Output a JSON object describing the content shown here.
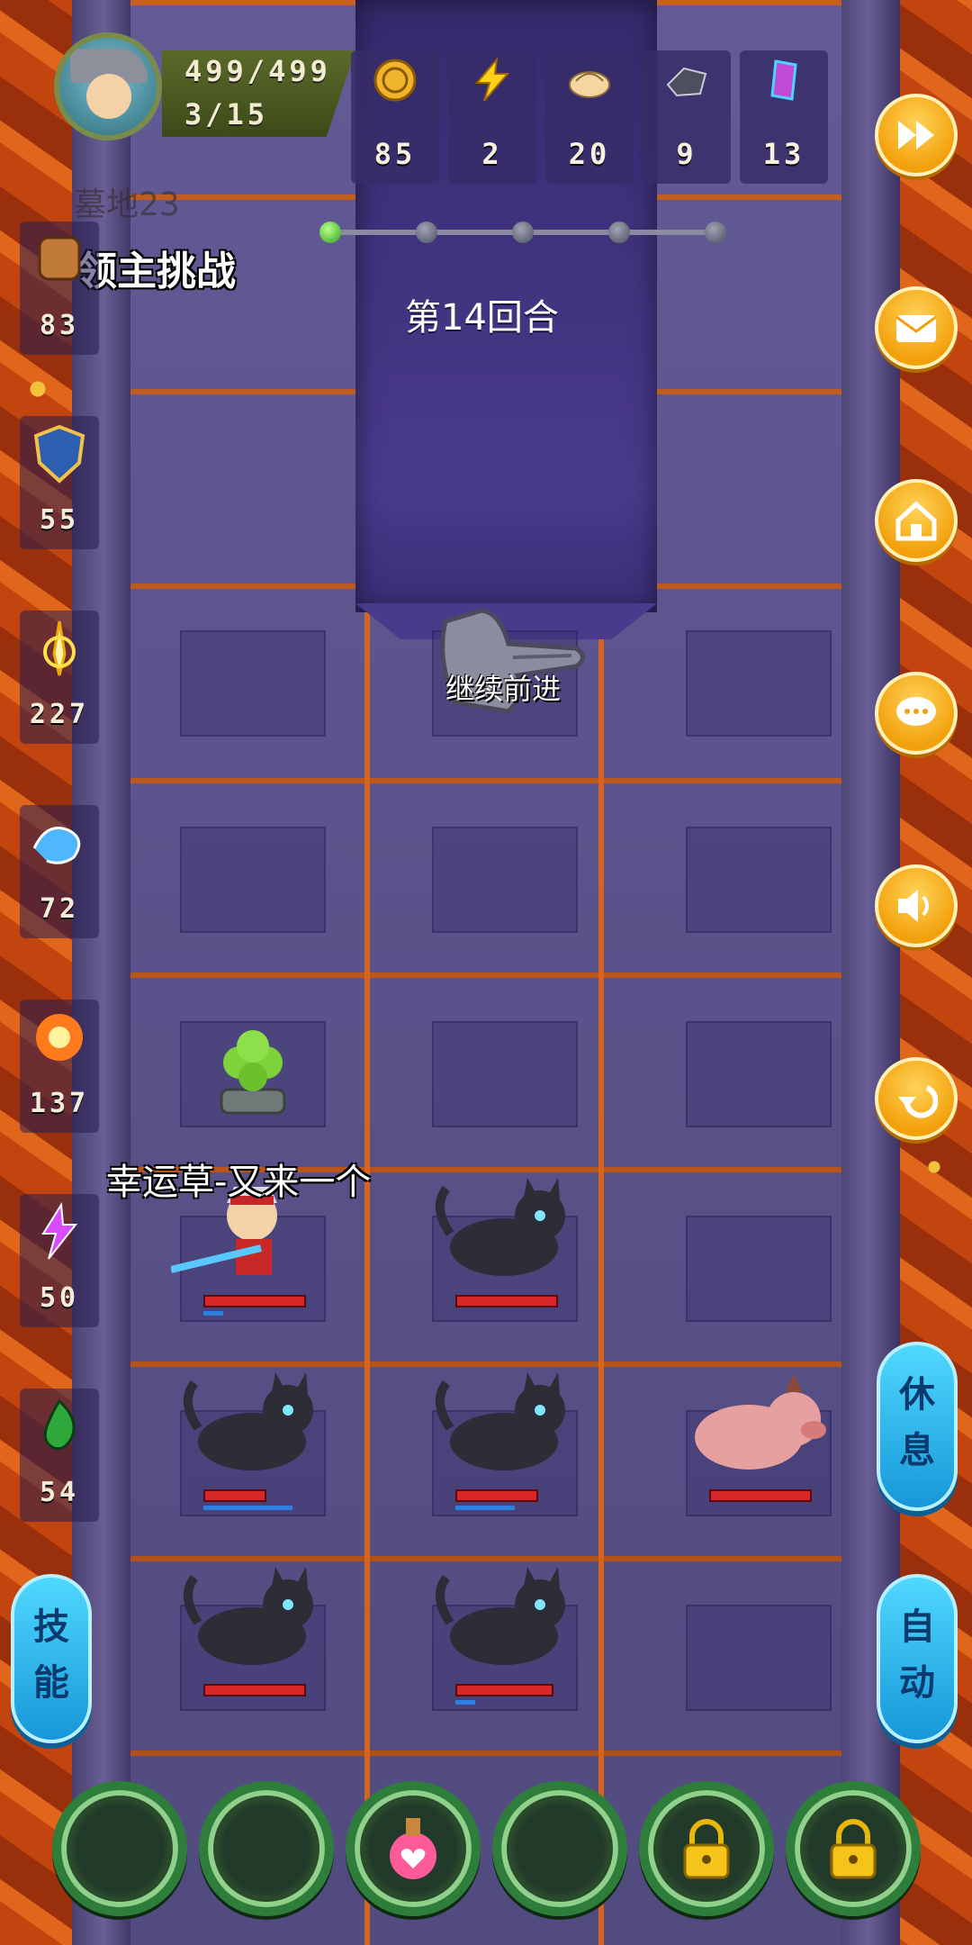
{
  "hud": {
    "hp": "499/499",
    "level": "3/15",
    "zone": "墓地23",
    "mode": "领主挑战",
    "round": "第14回合",
    "continue": "继续前进",
    "progress": {
      "total_stages": 5,
      "current_stage": 1
    }
  },
  "resources": [
    {
      "icon": "gold-coin-icon",
      "value": "85"
    },
    {
      "icon": "lightning-icon",
      "value": "2"
    },
    {
      "icon": "dumpling-icon",
      "value": "20"
    },
    {
      "icon": "iron-ore-icon",
      "value": "9"
    },
    {
      "icon": "crystal-icon",
      "value": "13"
    }
  ],
  "stats": [
    {
      "icon": "fist-icon",
      "value": "83"
    },
    {
      "icon": "shield-icon",
      "value": "55"
    },
    {
      "icon": "holy-sword-icon",
      "value": "227"
    },
    {
      "icon": "water-wave-icon",
      "value": "72"
    },
    {
      "icon": "fire-burst-icon",
      "value": "137"
    },
    {
      "icon": "lightning-bolt-icon",
      "value": "50"
    },
    {
      "icon": "poison-icon",
      "value": "54"
    }
  ],
  "right_buttons": [
    {
      "icon": "fast-forward-icon"
    },
    {
      "icon": "mail-icon"
    },
    {
      "icon": "home-icon"
    },
    {
      "icon": "chat-icon"
    },
    {
      "icon": "sound-icon"
    },
    {
      "icon": "back-arrow-icon"
    }
  ],
  "buff_text": "幸运草-又来一个",
  "side_pills": {
    "skill": [
      "技",
      "能"
    ],
    "rest": [
      "休",
      "息"
    ],
    "auto": [
      "自",
      "动"
    ]
  },
  "units": [
    {
      "type": "hero",
      "name": "hero",
      "hp": 1.0,
      "mp": 0.2
    },
    {
      "type": "cat",
      "name": "black-cat",
      "hp": 1.0,
      "mp": 0
    },
    {
      "type": "cat",
      "name": "black-cat",
      "hp": 0.6,
      "mp": 0.9
    },
    {
      "type": "cat",
      "name": "black-cat",
      "hp": 0.8,
      "mp": 0.6
    },
    {
      "type": "boar",
      "name": "boar",
      "hp": 1.0,
      "mp": 0
    },
    {
      "type": "cat",
      "name": "black-cat",
      "hp": 1.0,
      "mp": 0
    },
    {
      "type": "cat",
      "name": "black-cat",
      "hp": 0.95,
      "mp": 0.2
    }
  ],
  "slots": [
    {
      "state": "empty"
    },
    {
      "state": "empty"
    },
    {
      "state": "potion",
      "icon": "heart-potion-icon"
    },
    {
      "state": "empty"
    },
    {
      "state": "locked",
      "icon": "lock-icon"
    },
    {
      "state": "locked",
      "icon": "lock-icon"
    }
  ],
  "colors": {
    "hp": "#d62828",
    "mp": "#2e7fe0",
    "accent": "#f2a10c",
    "pill": "#1797d8"
  }
}
